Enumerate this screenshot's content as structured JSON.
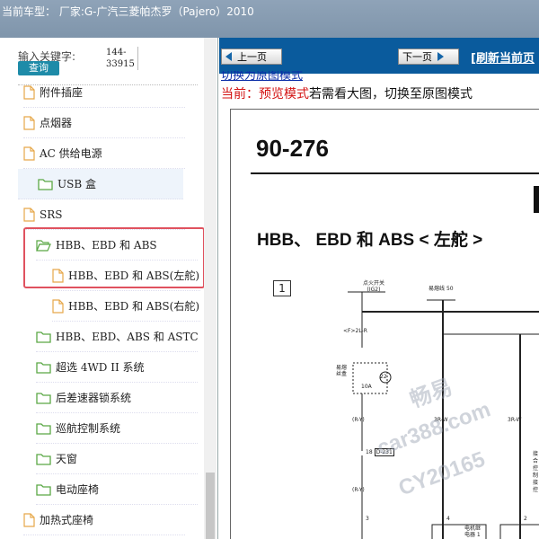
{
  "titlebar": {
    "title": "当前车型： 厂家:G-广汽三菱帕杰罗（Pajero）2010"
  },
  "search": {
    "label": "输入关键字:",
    "code_line1": "144-",
    "code_line2": "33915",
    "button": "查询"
  },
  "tree": {
    "items": [
      {
        "label": "附件插座",
        "type": "file"
      },
      {
        "label": "点烟器",
        "type": "file"
      },
      {
        "label": "AC 供给电源",
        "type": "file"
      },
      {
        "label": "USB 盒",
        "type": "folder"
      },
      {
        "label": "SRS",
        "type": "file"
      },
      {
        "label": "HBB、EBD 和 ABS",
        "type": "folder-open"
      },
      {
        "label": "HBB、EBD 和 ABS(左舵)",
        "type": "file"
      },
      {
        "label": "HBB、EBD 和 ABS(右舵)",
        "type": "file"
      },
      {
        "label": "HBB、EBD、ABS 和 ASTC",
        "type": "folder"
      },
      {
        "label": "超选 4WD II 系统",
        "type": "folder"
      },
      {
        "label": "后差速器锁系统",
        "type": "folder"
      },
      {
        "label": "巡航控制系统",
        "type": "folder"
      },
      {
        "label": "天窗",
        "type": "folder"
      },
      {
        "label": "电动座椅",
        "type": "folder"
      },
      {
        "label": "加热式座椅",
        "type": "file"
      }
    ]
  },
  "toolbar": {
    "prev": "上一页",
    "next": "下一页",
    "refresh": "[刷新当前页"
  },
  "view": {
    "switch_link": "切换为原图模式",
    "mode_prefix": "当前：预览模式",
    "mode_suffix": "若需看大图，切换至原图模式"
  },
  "document": {
    "page_number": "90-276",
    "section_title": "HBB、 EBD 和 ABS < 左舵 >",
    "box_number": "1",
    "labels": {
      "ignition": "点火开关",
      "ig2": "(IG2)",
      "fusible_link": "易熔线",
      "fl_num": "50",
      "wire_2lr": "<F>2L-R",
      "fuse_label": "易熔丝盒",
      "fuse_num": "22",
      "fuse_amp": "10A",
      "rv1": "(R-Y)",
      "rv2": "(R-Y)",
      "w3rw_1": "3R-W",
      "w3rw_2": "3R-W",
      "conn": "18",
      "conn_code": "D-231",
      "pin3": "3",
      "pin4": "4",
      "pin2": "2",
      "motor_relay": "电机继",
      "motor_relay2": "电器 1",
      "side1": "接",
      "side2": "合",
      "side3": "控",
      "side4": "制",
      "side5": "接",
      "side6": "控"
    },
    "watermark": {
      "line1": "畅易",
      "line2": "car388.com",
      "line3": "CY20165"
    }
  }
}
